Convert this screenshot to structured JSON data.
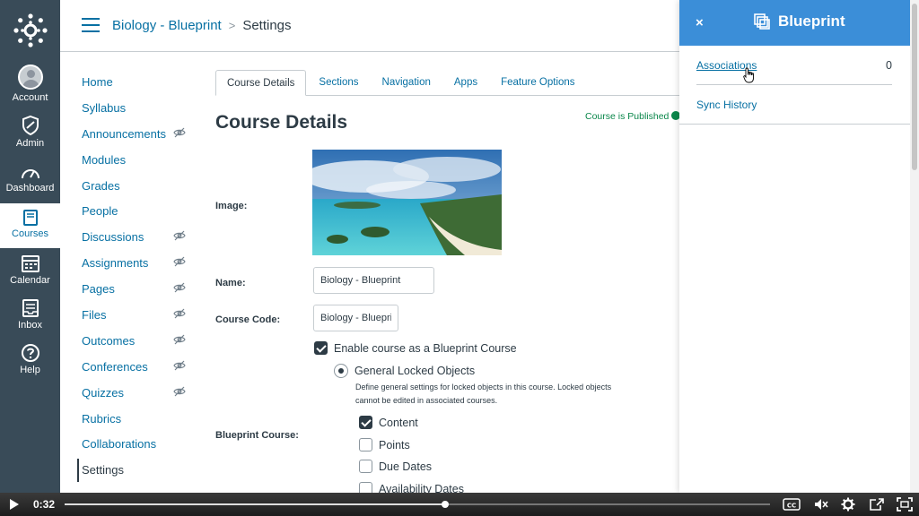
{
  "global_nav": {
    "items": [
      {
        "label": "Account"
      },
      {
        "label": "Admin"
      },
      {
        "label": "Dashboard"
      },
      {
        "label": "Courses"
      },
      {
        "label": "Calendar"
      },
      {
        "label": "Inbox"
      },
      {
        "label": "Help"
      }
    ],
    "active": "Courses"
  },
  "header": {
    "course": "Biology - Blueprint",
    "separator": ">",
    "current": "Settings"
  },
  "course_nav": {
    "items": [
      {
        "label": "Home",
        "hidden": false
      },
      {
        "label": "Syllabus",
        "hidden": false
      },
      {
        "label": "Announcements",
        "hidden": true
      },
      {
        "label": "Modules",
        "hidden": false
      },
      {
        "label": "Grades",
        "hidden": false
      },
      {
        "label": "People",
        "hidden": false
      },
      {
        "label": "Discussions",
        "hidden": true
      },
      {
        "label": "Assignments",
        "hidden": true
      },
      {
        "label": "Pages",
        "hidden": true
      },
      {
        "label": "Files",
        "hidden": true
      },
      {
        "label": "Outcomes",
        "hidden": true
      },
      {
        "label": "Conferences",
        "hidden": true
      },
      {
        "label": "Quizzes",
        "hidden": true
      },
      {
        "label": "Rubrics",
        "hidden": false
      },
      {
        "label": "Collaborations",
        "hidden": false
      },
      {
        "label": "Settings",
        "hidden": false
      }
    ],
    "active": "Settings"
  },
  "tabs": [
    "Course Details",
    "Sections",
    "Navigation",
    "Apps",
    "Feature Options"
  ],
  "main": {
    "title": "Course Details",
    "published": "Course is Published",
    "image_label": "Image:",
    "name_label": "Name:",
    "name_value": "Biology - Blueprint",
    "code_label": "Course Code:",
    "code_value": "Biology - Blueprint",
    "blueprint_checkbox": "Enable course as a Blueprint Course",
    "blueprint_label": "Blueprint Course:",
    "general_locked": "General Locked Objects",
    "general_desc": "Define general settings for locked objects in this course. Locked objects cannot be edited in associated courses.",
    "lock_options": [
      {
        "label": "Content",
        "checked": true
      },
      {
        "label": "Points",
        "checked": false
      },
      {
        "label": "Due Dates",
        "checked": false
      },
      {
        "label": "Availability Dates",
        "checked": false
      }
    ]
  },
  "tray": {
    "title": "Blueprint",
    "close": "×",
    "associations_label": "Associations",
    "associations_count": "0",
    "sync_history": "Sync History"
  },
  "player": {
    "time": "0:32",
    "progress": 0.54
  },
  "colors": {
    "nav_bg": "#394b58",
    "link": "#0770a3",
    "tray_header": "#3b8ed8",
    "published": "#0b874b"
  }
}
